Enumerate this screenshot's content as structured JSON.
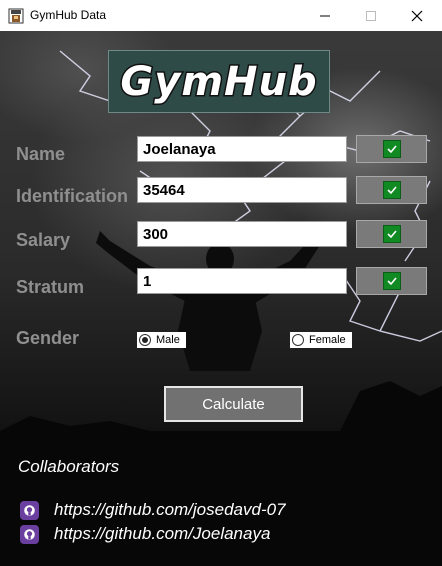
{
  "window": {
    "title": "GymHub Data"
  },
  "logo": {
    "text": "GymHub"
  },
  "form": {
    "fields": [
      {
        "label": "Name",
        "value": "Joelanaya"
      },
      {
        "label": "Identification",
        "value": "35464"
      },
      {
        "label": "Salary",
        "value": "300"
      },
      {
        "label": "Stratum",
        "value": "1"
      }
    ],
    "gender": {
      "label": "Gender",
      "options": [
        {
          "label": "Male",
          "selected": true
        },
        {
          "label": "Female",
          "selected": false
        }
      ]
    },
    "calculate_label": "Calculate"
  },
  "collaborators": {
    "title": "Collaborators",
    "links": [
      "https://github.com/josedavd-07",
      "https://github.com/Joelanaya"
    ]
  },
  "colors": {
    "logo_bg": "#2e4b48",
    "check_green": "#118a24",
    "github_icon": "#6b3fa0"
  }
}
